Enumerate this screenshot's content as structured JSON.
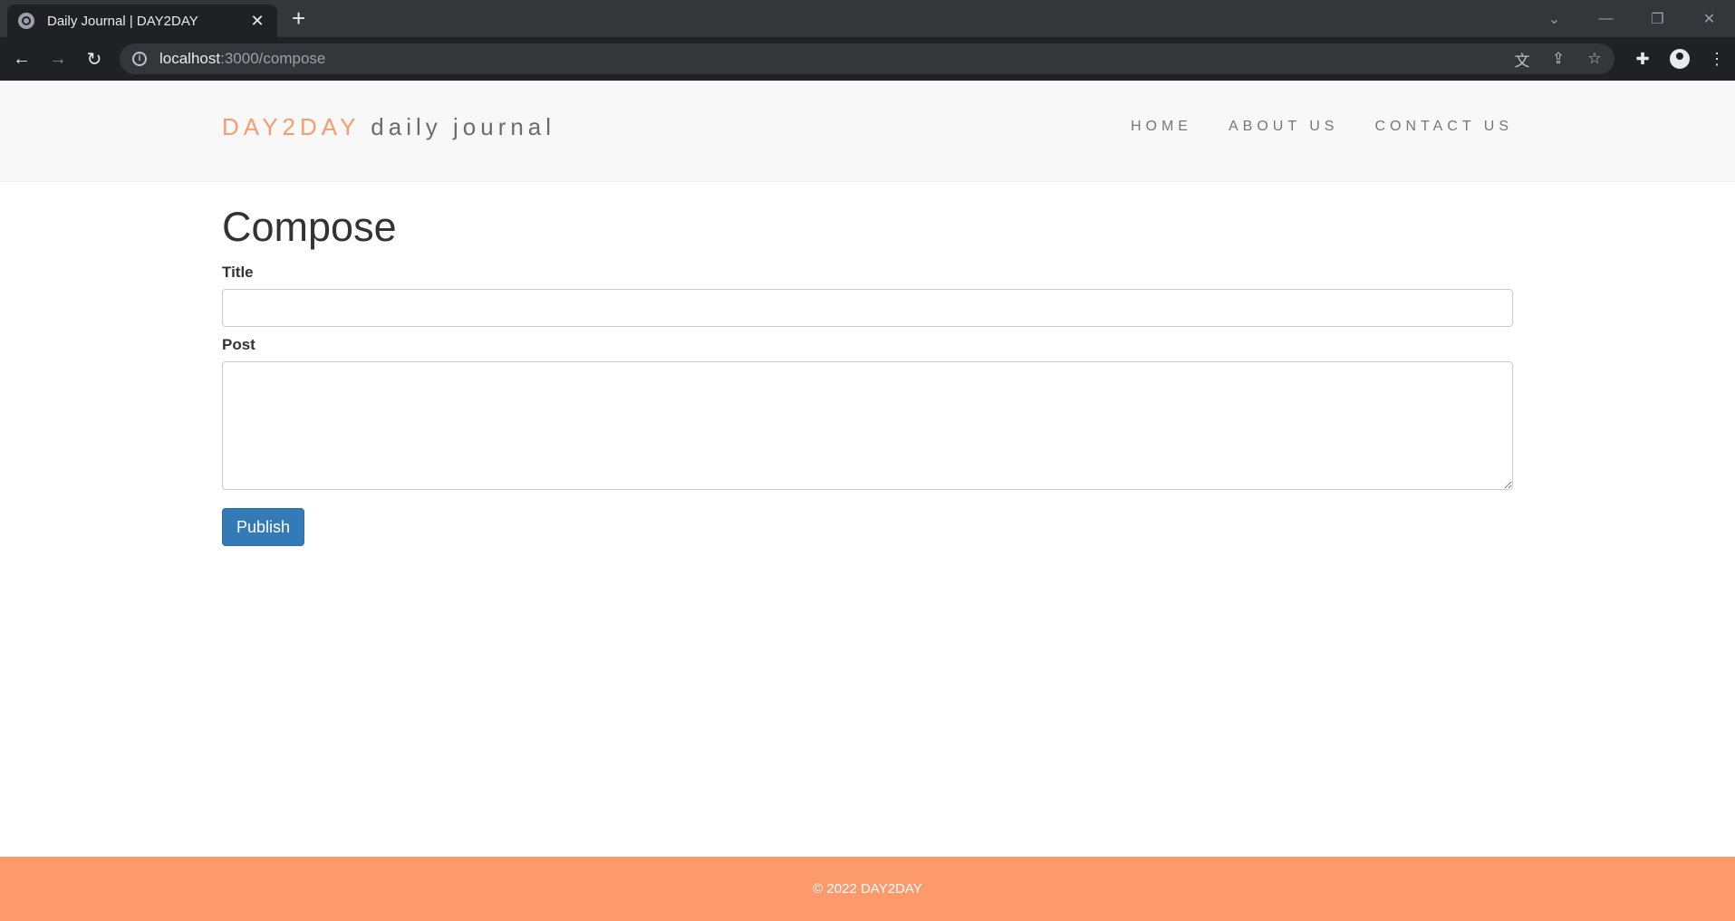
{
  "browser": {
    "tab_title": "Daily Journal | DAY2DAY",
    "new_tab_glyph": "+",
    "close_glyph": "✕",
    "url_host": "localhost",
    "url_path": ":3000/compose"
  },
  "navbar": {
    "brand_name": "DAY2DAY",
    "brand_tagline": "daily journal",
    "links": [
      "HOME",
      "ABOUT US",
      "CONTACT US"
    ]
  },
  "compose": {
    "heading": "Compose",
    "title_label": "Title",
    "title_value": "",
    "post_label": "Post",
    "post_value": "",
    "publish_label": "Publish"
  },
  "footer": {
    "text": "© 2022 DAY2DAY"
  },
  "colors": {
    "brand_accent": "#fc9a6c",
    "button_primary": "#337ab7",
    "navbar_bg": "#f8f8f8"
  }
}
